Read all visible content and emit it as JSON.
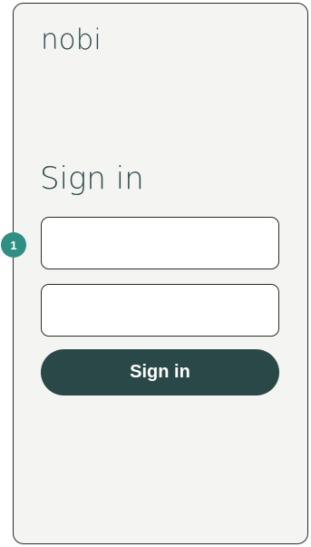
{
  "app": {
    "logo_text": "nobi"
  },
  "signin": {
    "heading": "Sign in",
    "username_value": "",
    "password_value": "",
    "button_label": "Sign in"
  },
  "annotation": {
    "marker_label": "1"
  },
  "colors": {
    "brand": "#2b4848",
    "marker": "#2f8f83",
    "background": "#f4f4f2"
  }
}
